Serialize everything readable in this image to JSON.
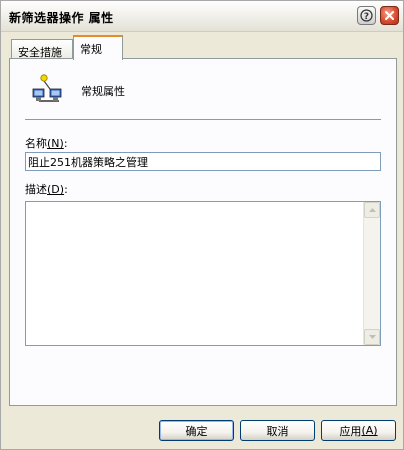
{
  "window": {
    "title": "新筛选器操作 属性"
  },
  "tabs": [
    {
      "label": "安全措施"
    },
    {
      "label": "常规"
    }
  ],
  "general": {
    "heading": "常规属性",
    "name_label": "名称",
    "name_mnemonic": "(N)",
    "name_colon": ":",
    "name_value": "阻止251机器策略之管理",
    "desc_label": "描述",
    "desc_mnemonic": "(D)",
    "desc_colon": ":",
    "desc_value": ""
  },
  "buttons": {
    "ok": "确定",
    "cancel": "取消",
    "apply": "应用",
    "apply_mnemonic": "(A)"
  },
  "icons": {
    "help": "help-icon",
    "close": "close-icon",
    "network": "network-filter-icon"
  },
  "colors": {
    "tab_accent": "#e68b2c",
    "close_red": "#d64a2e",
    "field_border": "#7f9db9"
  }
}
